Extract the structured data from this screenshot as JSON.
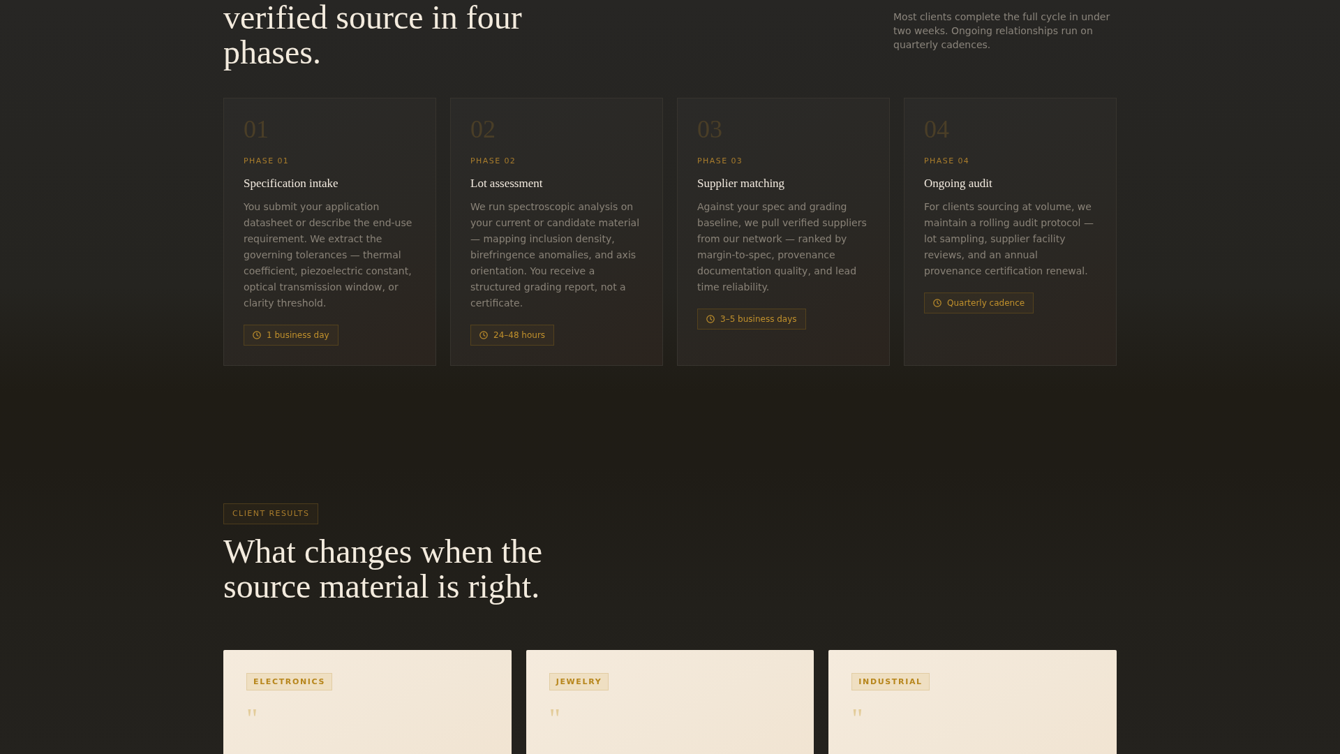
{
  "intro": {
    "heading": "verified source in four phases.",
    "note": "Most clients complete the full cycle in under two weeks. Ongoing relationships run on quarterly cadences."
  },
  "phases": [
    {
      "number": "01",
      "label": "PHASE 01",
      "title": "Specification intake",
      "description": "You submit your application datasheet or describe the end-use requirement. We extract the governing tolerances — thermal coefficient, piezoelectric constant, optical transmission window, or clarity threshold.",
      "duration": "1 business day"
    },
    {
      "number": "02",
      "label": "PHASE 02",
      "title": "Lot assessment",
      "description": "We run spectroscopic analysis on your current or candidate material — mapping inclusion density, birefringence anomalies, and axis orientation. You receive a structured grading report, not a certificate.",
      "duration": "24–48 hours"
    },
    {
      "number": "03",
      "label": "PHASE 03",
      "title": "Supplier matching",
      "description": "Against your spec and grading baseline, we pull verified suppliers from our network — ranked by margin-to-spec, provenance documentation quality, and lead time reliability.",
      "duration": "3–5 business days"
    },
    {
      "number": "04",
      "label": "PHASE 04",
      "title": "Ongoing audit",
      "description": "For clients sourcing at volume, we maintain a rolling audit protocol — lot sampling, supplier facility reviews, and an annual provenance certification renewal.",
      "duration": "Quarterly cadence"
    }
  ],
  "results": {
    "tag": "CLIENT RESULTS",
    "heading": "What changes when the source material is right.",
    "cards": [
      {
        "tag": "ELECTRONICS",
        "quote_mark": "\""
      },
      {
        "tag": "JEWELRY",
        "quote_mark": "\""
      },
      {
        "tag": "INDUSTRIAL",
        "quote_mark": "\""
      }
    ]
  }
}
